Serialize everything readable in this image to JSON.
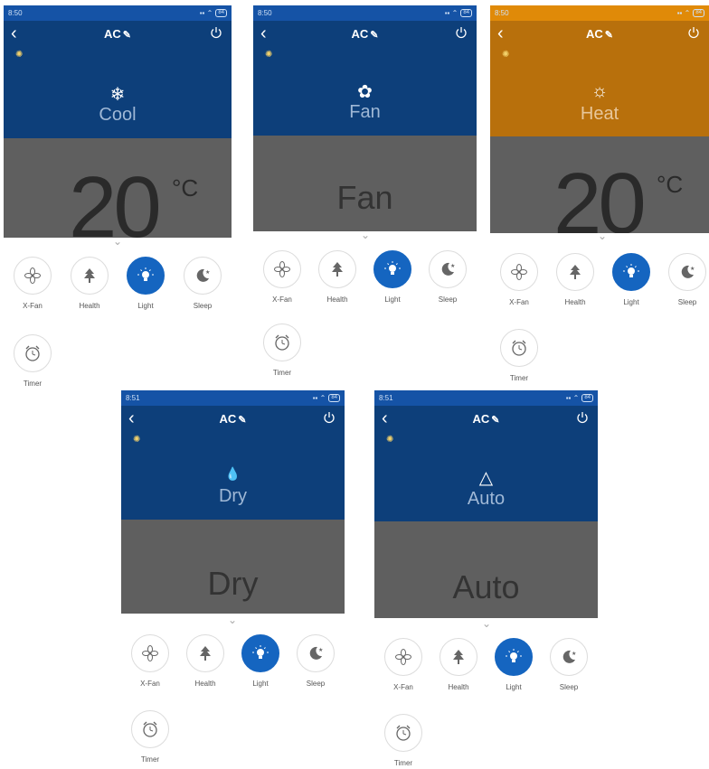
{
  "screens": [
    {
      "id": "cool",
      "time": "8:50",
      "battery": "84",
      "title": "AC",
      "mode_glyph": "❄",
      "mode_name": "Cool",
      "temp": "20",
      "unit": "°C",
      "big_mode": "",
      "accent": "#0d3f7a"
    },
    {
      "id": "fan",
      "time": "8:50",
      "battery": "84",
      "title": "AC",
      "mode_glyph": "✿",
      "mode_name": "Fan",
      "temp": "",
      "unit": "",
      "big_mode": "Fan",
      "accent": "#0d3f7a"
    },
    {
      "id": "heat",
      "time": "8:50",
      "battery": "84",
      "title": "AC",
      "mode_glyph": "☼",
      "mode_name": "Heat",
      "temp": "20",
      "unit": "°C",
      "big_mode": "",
      "accent": "#cf7a06"
    },
    {
      "id": "dry",
      "time": "8:51",
      "battery": "84",
      "title": "AC",
      "mode_glyph": "💧",
      "mode_name": "Dry",
      "temp": "",
      "unit": "",
      "big_mode": "Dry",
      "accent": "#0d3f7a"
    },
    {
      "id": "auto",
      "time": "8:51",
      "battery": "84",
      "title": "AC",
      "mode_glyph": "△",
      "mode_name": "Auto",
      "temp": "",
      "unit": "",
      "big_mode": "Auto",
      "accent": "#0d3f7a"
    }
  ],
  "buttons": {
    "xfan": "X-Fan",
    "health": "Health",
    "light": "Light",
    "sleep": "Sleep",
    "timer": "Timer"
  },
  "icons": {
    "back": "back-icon",
    "power": "power-icon",
    "edit": "pencil-icon"
  },
  "colors": {
    "blue_bg": "#0d3f7a",
    "orange_bg": "#d98007",
    "light_on": "#1565c0",
    "gray_panel": "#5f5f5f"
  }
}
